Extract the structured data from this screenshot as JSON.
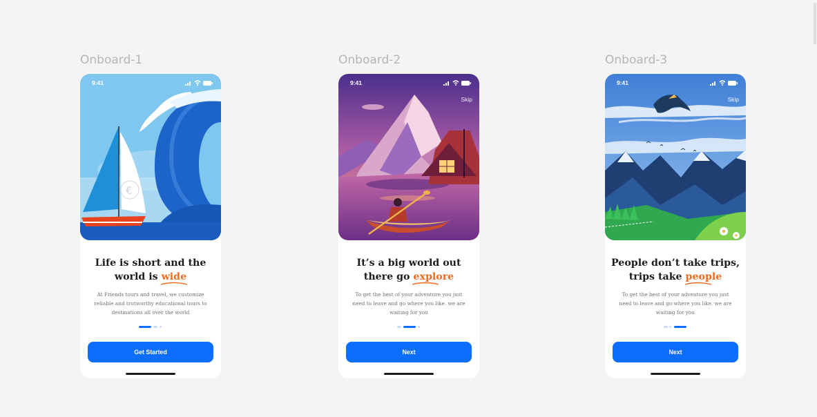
{
  "screens": [
    {
      "frame_label": "Onboard-1",
      "status_time": "9:41",
      "title_line1": "Life is short and the",
      "title_line2_prefix": "world is ",
      "title_accent": "wide",
      "description": "At Friends tours and travel, we customize reliable and trutworthy educational tours to destinations all over the world",
      "button_label": "Get Started",
      "active_page": 1,
      "page_count": 3
    },
    {
      "frame_label": "Onboard-2",
      "status_time": "9:41",
      "skip_label": "Skip",
      "title_line1": "It’s a big world out",
      "title_line2_prefix": "there go ",
      "title_accent": "explore",
      "description": "To get the best of your adventure you just need to leave and go where you like. we are waiting for you",
      "button_label": "Next",
      "active_page": 2,
      "page_count": 3
    },
    {
      "frame_label": "Onboard-3",
      "status_time": "9:41",
      "skip_label": "Skip",
      "title_line1": "People don’t take trips,",
      "title_line2_prefix": "trips take ",
      "title_accent": "people",
      "description": "To get the best of your adventure you just need to leave and go where you like. we are waiting for you",
      "button_label": "Next",
      "active_page": 3,
      "page_count": 3
    }
  ],
  "colors": {
    "primary_button": "#0d6efd",
    "accent_text": "#ef6b1f",
    "title_text": "#1c1c1e",
    "body_text": "#6f6f74",
    "canvas": "#f4f4f4"
  },
  "icons": [
    "cellular-signal-icon",
    "wifi-icon",
    "battery-icon"
  ]
}
